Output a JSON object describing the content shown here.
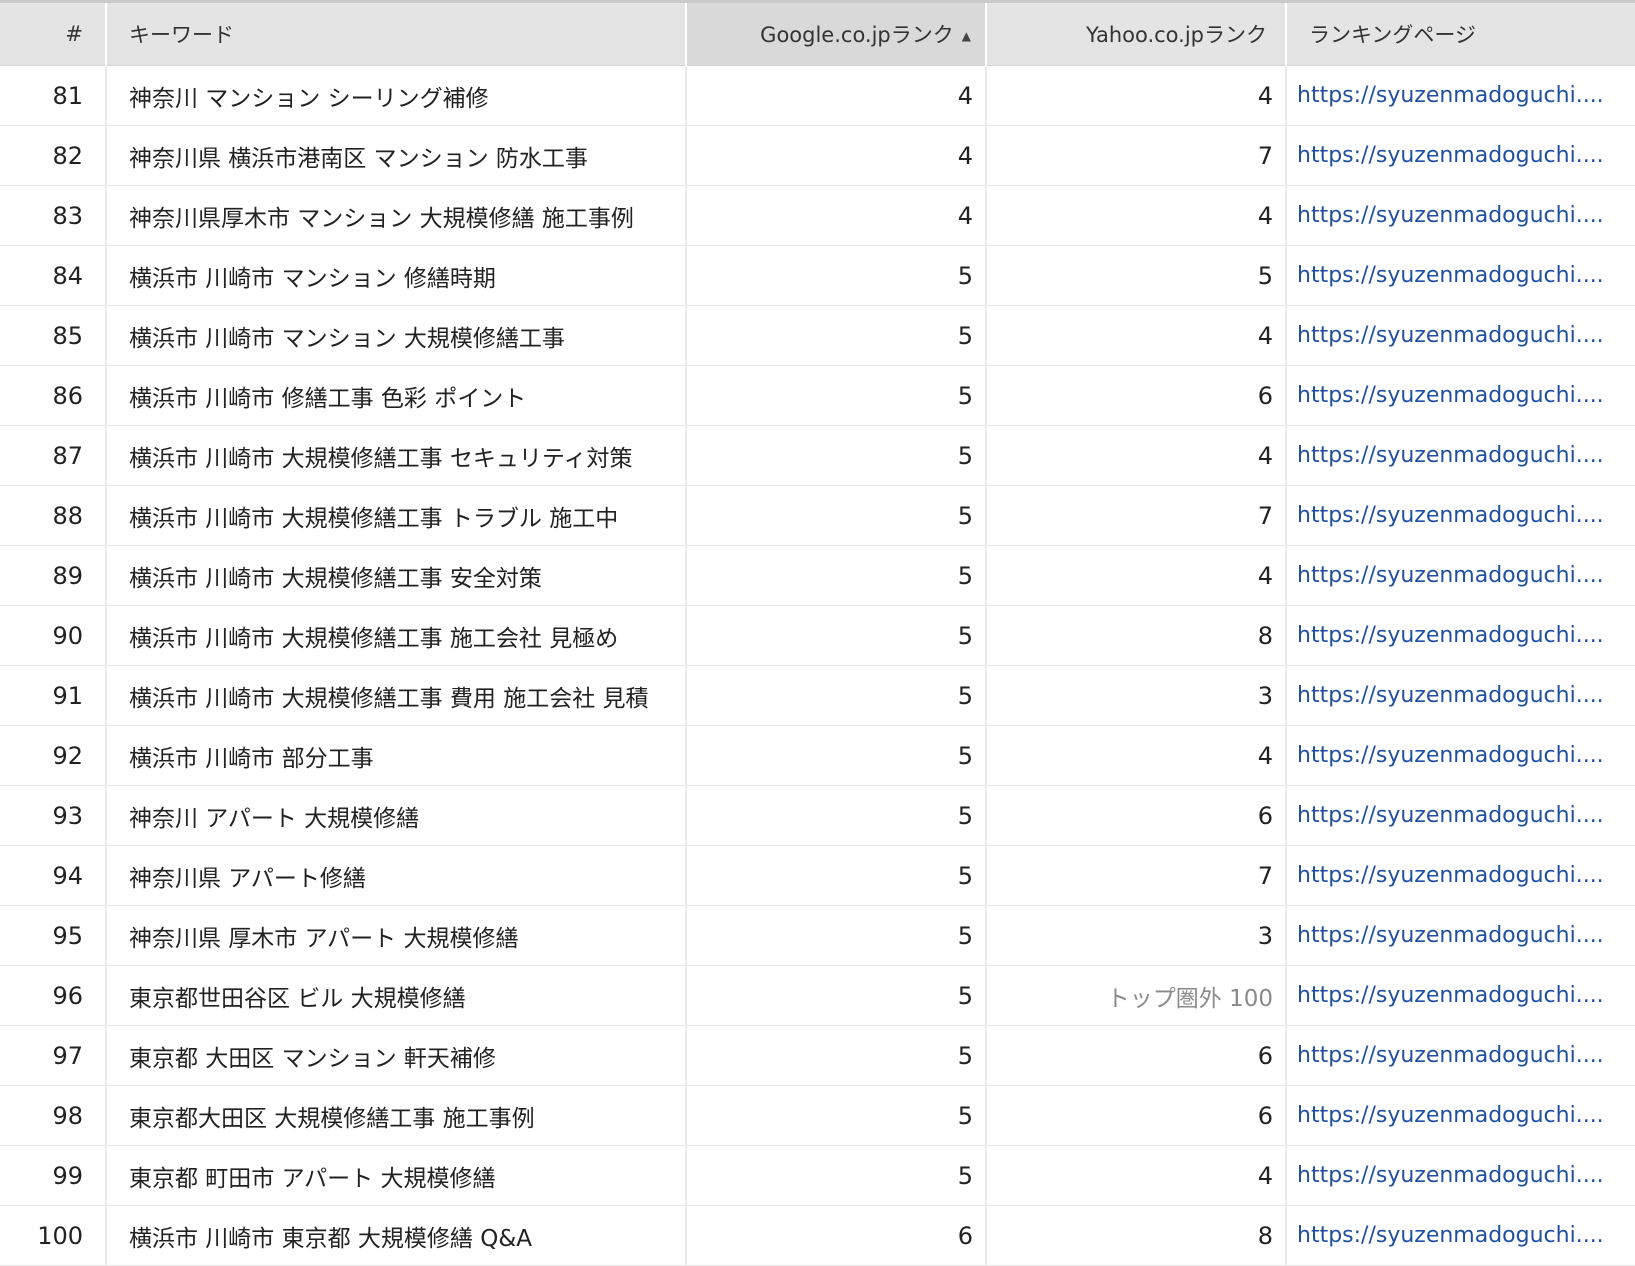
{
  "table": {
    "headers": {
      "num": "#",
      "keyword": "キーワード",
      "google": "Google.co.jpランク",
      "yahoo": "Yahoo.co.jpランク",
      "page": "ランキングページ"
    },
    "sort": {
      "column": "google",
      "direction": "ascending",
      "indicator_icon": "sort-ascending-triangle"
    },
    "link_color": "#1f4f9e",
    "rows": [
      {
        "num": "81",
        "keyword": "神奈川 マンション シーリング補修",
        "google": "4",
        "yahoo": "4",
        "url": "https://syuzenmadoguchi...."
      },
      {
        "num": "82",
        "keyword": "神奈川県 横浜市港南区 マンション 防水工事",
        "google": "4",
        "yahoo": "7",
        "url": "https://syuzenmadoguchi...."
      },
      {
        "num": "83",
        "keyword": "神奈川県厚木市 マンション 大規模修繕 施工事例",
        "google": "4",
        "yahoo": "4",
        "url": "https://syuzenmadoguchi...."
      },
      {
        "num": "84",
        "keyword": "横浜市 川崎市 マンション 修繕時期",
        "google": "5",
        "yahoo": "5",
        "url": "https://syuzenmadoguchi...."
      },
      {
        "num": "85",
        "keyword": "横浜市 川崎市 マンション 大規模修繕工事",
        "google": "5",
        "yahoo": "4",
        "url": "https://syuzenmadoguchi...."
      },
      {
        "num": "86",
        "keyword": "横浜市 川崎市 修繕工事 色彩 ポイント",
        "google": "5",
        "yahoo": "6",
        "url": "https://syuzenmadoguchi...."
      },
      {
        "num": "87",
        "keyword": "横浜市 川崎市 大規模修繕工事 セキュリティ対策",
        "google": "5",
        "yahoo": "4",
        "url": "https://syuzenmadoguchi...."
      },
      {
        "num": "88",
        "keyword": "横浜市 川崎市 大規模修繕工事 トラブル 施工中",
        "google": "5",
        "yahoo": "7",
        "url": "https://syuzenmadoguchi...."
      },
      {
        "num": "89",
        "keyword": "横浜市 川崎市 大規模修繕工事 安全対策",
        "google": "5",
        "yahoo": "4",
        "url": "https://syuzenmadoguchi...."
      },
      {
        "num": "90",
        "keyword": "横浜市 川崎市 大規模修繕工事 施工会社 見極め",
        "google": "5",
        "yahoo": "8",
        "url": "https://syuzenmadoguchi...."
      },
      {
        "num": "91",
        "keyword": "横浜市 川崎市 大規模修繕工事 費用 施工会社 見積",
        "google": "5",
        "yahoo": "3",
        "url": "https://syuzenmadoguchi...."
      },
      {
        "num": "92",
        "keyword": "横浜市 川崎市 部分工事",
        "google": "5",
        "yahoo": "4",
        "url": "https://syuzenmadoguchi...."
      },
      {
        "num": "93",
        "keyword": "神奈川 アパート 大規模修繕",
        "google": "5",
        "yahoo": "6",
        "url": "https://syuzenmadoguchi...."
      },
      {
        "num": "94",
        "keyword": "神奈川県 アパート修繕",
        "google": "5",
        "yahoo": "7",
        "url": "https://syuzenmadoguchi...."
      },
      {
        "num": "95",
        "keyword": "神奈川県 厚木市 アパート 大規模修繕",
        "google": "5",
        "yahoo": "3",
        "url": "https://syuzenmadoguchi...."
      },
      {
        "num": "96",
        "keyword": "東京都世田谷区 ビル 大規模修繕",
        "google": "5",
        "yahoo": "トップ圏外 100",
        "yahoo_out": true,
        "url": "https://syuzenmadoguchi...."
      },
      {
        "num": "97",
        "keyword": "東京都 大田区 マンション 軒天補修",
        "google": "5",
        "yahoo": "6",
        "url": "https://syuzenmadoguchi...."
      },
      {
        "num": "98",
        "keyword": "東京都大田区 大規模修繕工事 施工事例",
        "google": "5",
        "yahoo": "6",
        "url": "https://syuzenmadoguchi...."
      },
      {
        "num": "99",
        "keyword": "東京都 町田市 アパート 大規模修繕",
        "google": "5",
        "yahoo": "4",
        "url": "https://syuzenmadoguchi...."
      },
      {
        "num": "100",
        "keyword": "横浜市 川崎市 東京都 大規模修繕 Q&A",
        "google": "6",
        "yahoo": "8",
        "url": "https://syuzenmadoguchi...."
      }
    ]
  }
}
